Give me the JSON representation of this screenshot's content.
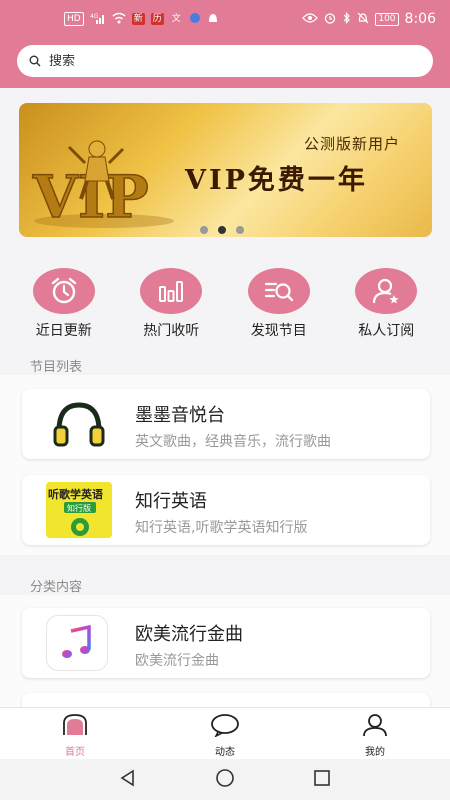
{
  "status_bar": {
    "left_chips": [
      "HD",
      "4G"
    ],
    "app_badges": [
      "新",
      "历",
      "文"
    ],
    "battery": "100",
    "time": "8:06"
  },
  "search": {
    "placeholder": "搜索"
  },
  "banner": {
    "tag": "公测版新用户",
    "headline": "VIP免费一年",
    "logo_text": "VIP",
    "slides": 3,
    "active_slide": 2
  },
  "quick_nav": [
    {
      "label": "近日更新",
      "icon": "alarm-clock-icon"
    },
    {
      "label": "热门收听",
      "icon": "bar-chart-icon"
    },
    {
      "label": "发现节目",
      "icon": "list-search-icon"
    },
    {
      "label": "私人订阅",
      "icon": "user-star-icon"
    }
  ],
  "program_list": {
    "title": "节目列表",
    "items": [
      {
        "title": "墨墨音悦台",
        "desc": "英文歌曲，经典音乐，流行歌曲",
        "icon": "headphones-icon"
      },
      {
        "title": "知行英语",
        "desc": "知行英语,听歌学英语知行版",
        "icon": "book-cover-icon",
        "cover_text": "听歌学英语",
        "cover_sub": "知行版"
      }
    ]
  },
  "category": {
    "title": "分类内容",
    "items": [
      {
        "title": "欧美流行金曲",
        "desc": "欧美流行金曲",
        "icon": "music-note-icon"
      }
    ]
  },
  "tabs": [
    {
      "label": "首页",
      "icon": "home-icon",
      "active": true
    },
    {
      "label": "动态",
      "icon": "chat-icon",
      "active": false
    },
    {
      "label": "我的",
      "icon": "profile-icon",
      "active": false
    }
  ],
  "colors": {
    "accent": "#e27b96",
    "banner_gold": "#f0c246"
  }
}
